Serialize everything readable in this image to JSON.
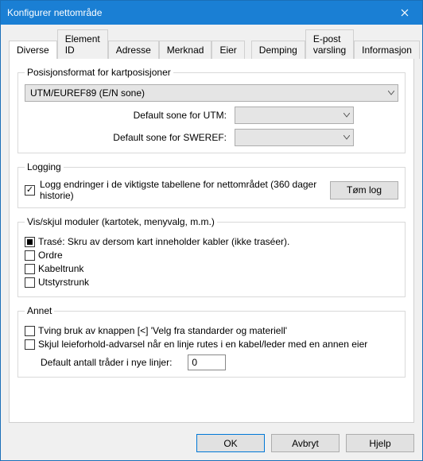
{
  "title": "Konfigurer nettområde",
  "tabs": [
    "Diverse",
    "Element ID",
    "Adresse",
    "Merknad",
    "Eier",
    "Demping",
    "E-post varsling",
    "Informasjon"
  ],
  "active_tab": 0,
  "posfmt": {
    "legend": "Posisjonsformat for kartposisjoner",
    "select_value": "UTM/EUREF89 (E/N sone)",
    "utm_label": "Default sone for UTM:",
    "sweref_label": "Default sone for SWEREF:"
  },
  "logging": {
    "legend": "Logging",
    "checkbox_label": "Logg endringer i de viktigste tabellene for nettområdet (360 dager historie)",
    "checked": true,
    "clear_button": "Tøm log"
  },
  "modules": {
    "legend": "Vis/skjul moduler (kartotek, menyvalg, m.m.)",
    "items": [
      {
        "label": "Trasé: Skru av dersom kart inneholder kabler (ikke traséer).",
        "state": "indeterminate"
      },
      {
        "label": "Ordre",
        "state": "unchecked"
      },
      {
        "label": "Kabeltrunk",
        "state": "unchecked"
      },
      {
        "label": "Utstyrstrunk",
        "state": "unchecked"
      }
    ]
  },
  "annet": {
    "legend": "Annet",
    "force_button": "Tving bruk av knappen [<] 'Velg fra standarder og materiell'",
    "hide_warning": "Skjul leieforhold-advarsel når en linje rutes i en kabel/leder med en annen eier",
    "default_threads_label": "Default antall tråder i nye linjer:",
    "default_threads_value": "0"
  },
  "footer": {
    "ok": "OK",
    "cancel": "Avbryt",
    "help": "Hjelp"
  }
}
